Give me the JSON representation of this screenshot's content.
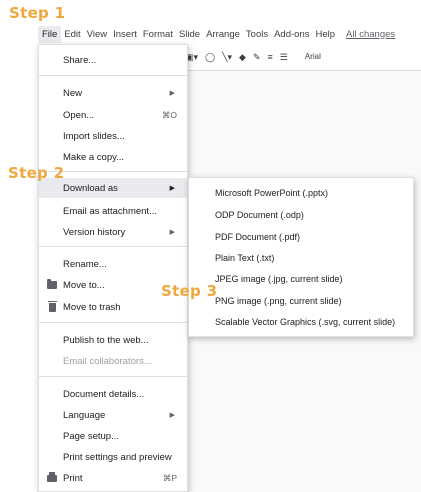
{
  "annotations": {
    "step1": "Step 1",
    "step2": "Step 2",
    "step3": "Step 3"
  },
  "menubar": {
    "items": [
      "File",
      "Edit",
      "View",
      "Insert",
      "Format",
      "Slide",
      "Arrange",
      "Tools",
      "Add-ons",
      "Help"
    ],
    "changes_link": "All changes"
  },
  "toolbar": {
    "font": "Arial"
  },
  "file_menu": {
    "share": "Share...",
    "new": "New",
    "open": "Open...",
    "open_shortcut": "⌘O",
    "import_slides": "Import slides...",
    "make_copy": "Make a copy...",
    "download_as": "Download as",
    "email_attachment": "Email as attachment...",
    "version_history": "Version history",
    "rename": "Rename...",
    "move_to": "Move to...",
    "move_to_trash": "Move to trash",
    "publish": "Publish to the web...",
    "email_collaborators": "Email collaborators...",
    "document_details": "Document details...",
    "language": "Language",
    "page_setup": "Page setup...",
    "print_settings": "Print settings and preview",
    "print": "Print",
    "print_shortcut": "⌘P"
  },
  "download_submenu": {
    "items": [
      "Microsoft PowerPoint (.pptx)",
      "ODP Document (.odp)",
      "PDF Document (.pdf)",
      "Plain Text (.txt)",
      "JPEG image (.jpg, current slide)",
      "PNG image (.png, current slide)",
      "Scalable Vector Graphics (.svg, current slide)"
    ]
  },
  "colors": {
    "step_label": "#f0a83c",
    "menu_highlight": "#e8eaed"
  },
  "icons": {
    "folder": "folder-icon",
    "trash": "trash-icon",
    "printer": "printer-icon"
  }
}
